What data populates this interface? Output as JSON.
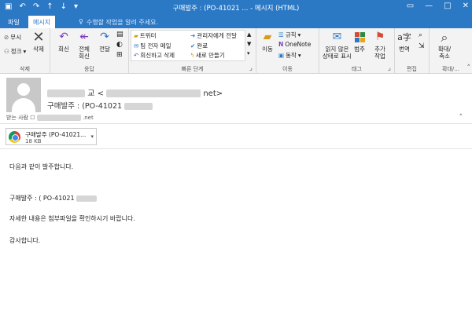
{
  "titlebar": {
    "title": "구매발주 : (PO-41021 ... - 메시지 (HTML)",
    "qat_icons": [
      "save-icon",
      "undo-icon",
      "redo-icon",
      "up-arrow-icon",
      "down-arrow-icon",
      "customize-icon"
    ],
    "winctl_icons": [
      "ribbon-options-icon",
      "minimize-icon",
      "maximize-icon",
      "close-icon"
    ]
  },
  "tabs": {
    "file": "파일",
    "message": "메시지",
    "tellme": "수행할 작업을 알려 주세요."
  },
  "ribbon": {
    "delete_group": {
      "ignore": "무시",
      "junk": "정크",
      "delete": "삭제",
      "label": "삭제"
    },
    "respond_group": {
      "reply": "회신",
      "reply_all": "전체\n회신",
      "forward": "전달",
      "label": "응답"
    },
    "quicksteps_group": {
      "items": [
        "트위터",
        "관리자에게 전달",
        "팀 전자 메일",
        "완료",
        "회신하고 삭제",
        "새로 만들기"
      ],
      "label": "빠른 단계"
    },
    "move_group": {
      "move": "이동",
      "rules": "규칙",
      "onenote": "OneNote",
      "actions": "동작",
      "label": "이동"
    },
    "tags_group": {
      "mark_unread": "읽지 않은\n상태로 표시",
      "categorize": "범주",
      "follow_up": "추가\n작업",
      "label": "태그"
    },
    "editing_group": {
      "translate": "번역",
      "label": "편집"
    },
    "zoom_group": {
      "zoom": "확대/\n축소",
      "label": "확대/..."
    }
  },
  "header": {
    "sender_suffix": "교 <",
    "sender_domain": "net>",
    "subject_prefix": "구매발주 : (PO-41021",
    "to_label": "받는 사람",
    "to_domain": ".net"
  },
  "attachment": {
    "name": "구매발주 (PO-41021...",
    "size": "18 KB"
  },
  "body": {
    "line1": "다음과 같이 발주합니다.",
    "line2": "구매발주 : ( PO-41021",
    "line3": "자세한 내용은 첨부파일을 확인하시기 바랍니다.",
    "line4": "감사합니다."
  }
}
